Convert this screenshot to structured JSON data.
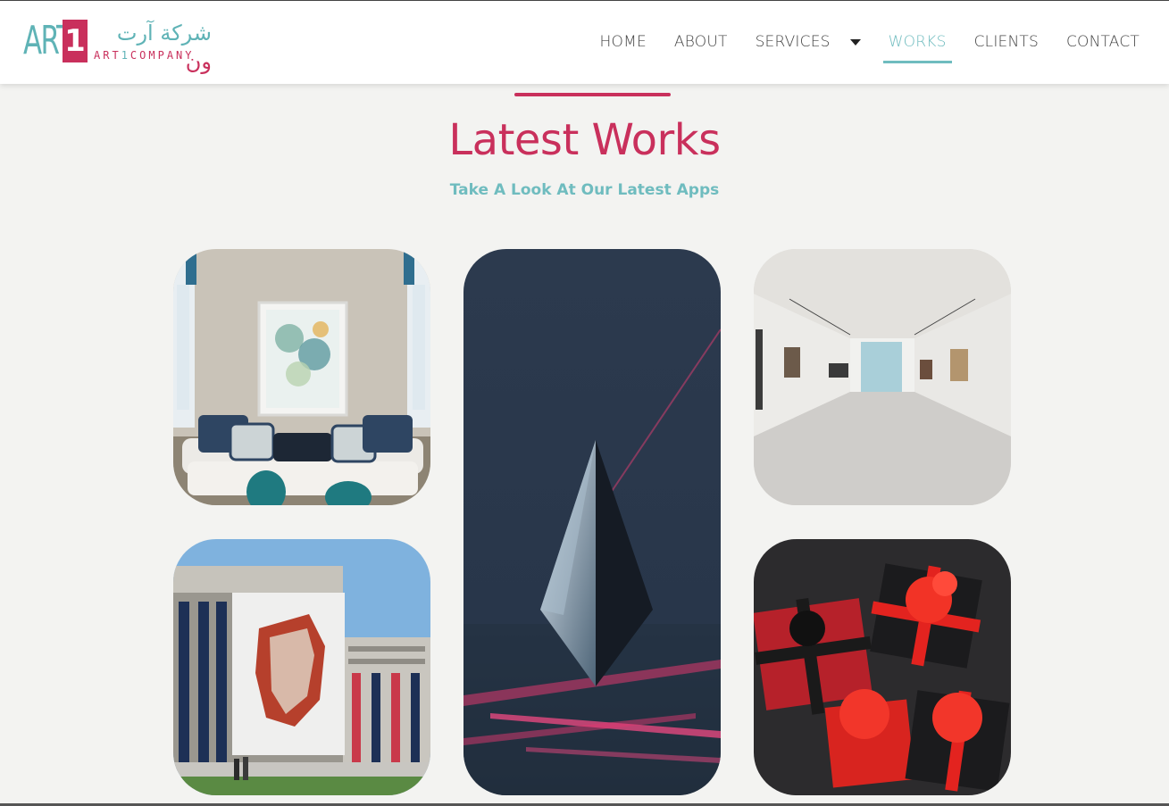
{
  "header": {
    "logo": {
      "art": "ART",
      "one": "1",
      "arabic_prefix": "شركة آرت",
      "arabic_suffix": "ون",
      "sub_art": "ART",
      "sub_one": "1",
      "sub_company": "COMPANY"
    },
    "nav": [
      {
        "label": "HOME",
        "active": false
      },
      {
        "label": "ABOUT",
        "active": false
      },
      {
        "label": "SERVICES",
        "active": false,
        "has_dropdown": true
      },
      {
        "label": "WORKS",
        "active": true
      },
      {
        "label": "CLIENTS",
        "active": false
      },
      {
        "label": "CONTACT",
        "active": false
      }
    ]
  },
  "section": {
    "title": "Latest Works",
    "subtitle": "Take A Look At Our Latest Apps"
  },
  "works": [
    {
      "name": "living-room-painting"
    },
    {
      "name": "crystal-prism"
    },
    {
      "name": "art-gallery-hall"
    },
    {
      "name": "building-mural"
    },
    {
      "name": "red-gift-boxes"
    }
  ],
  "colors": {
    "primary_pink": "#c9305c",
    "teal": "#6fbcbf",
    "background": "#f3f3f1",
    "nav_text": "#444444"
  }
}
